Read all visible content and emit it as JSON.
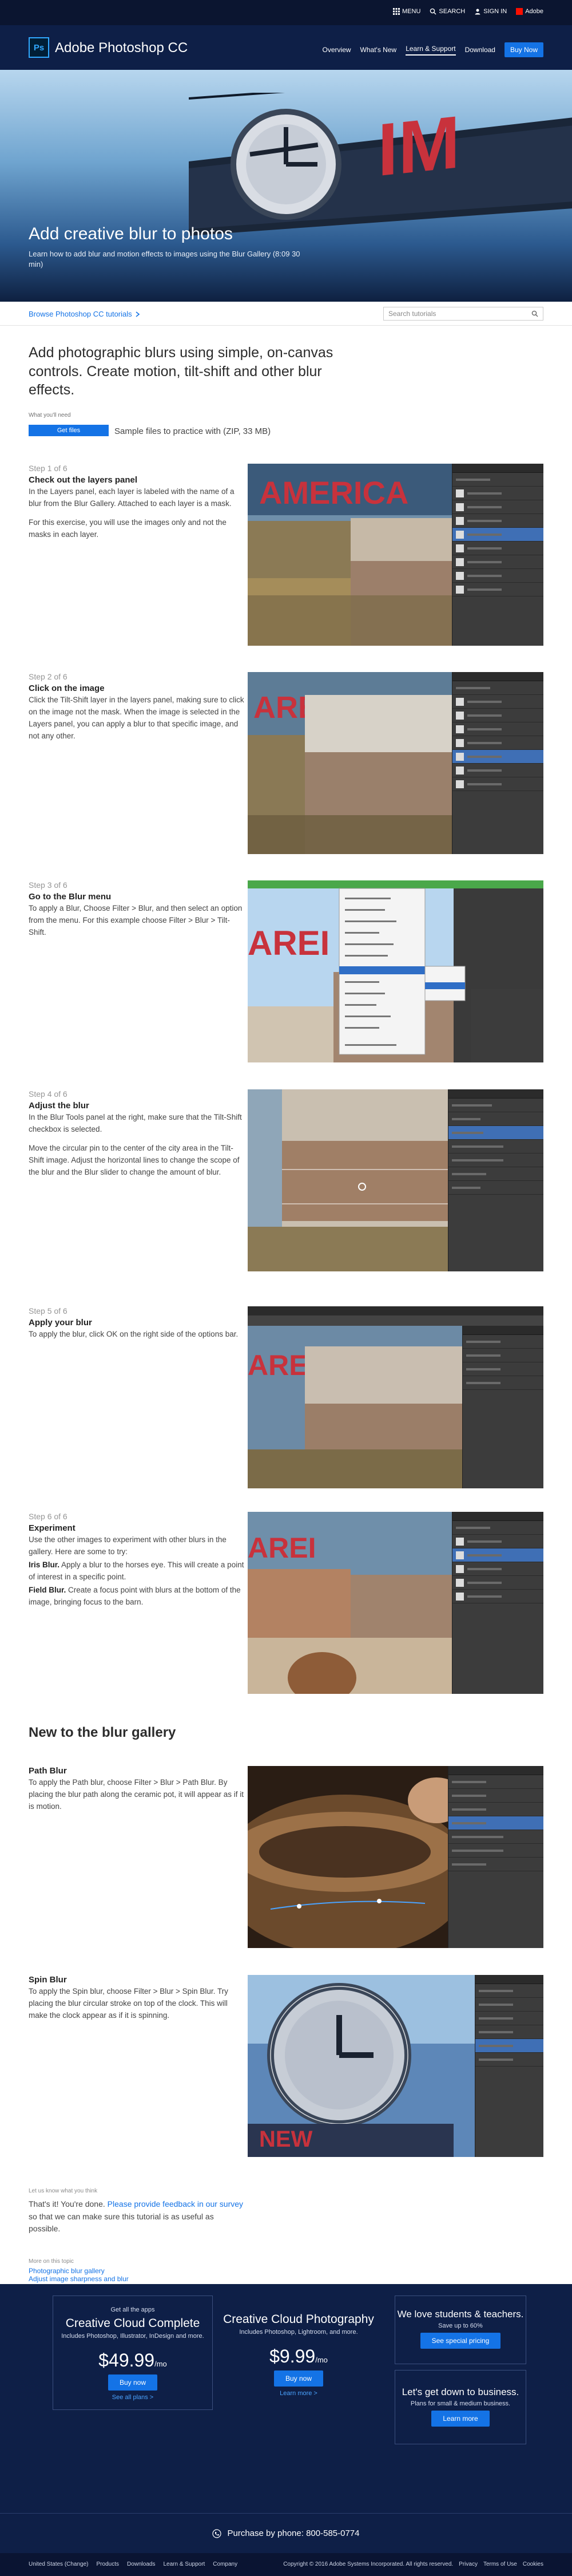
{
  "global_nav": {
    "menu": "MENU",
    "search": "SEARCH",
    "sign_in": "SIGN IN",
    "adobe": "Adobe"
  },
  "product_bar": {
    "logo_text": "Ps",
    "title": "Adobe Photoshop CC",
    "nav": [
      "Overview",
      "What's New",
      "Learn & Support",
      "Download"
    ],
    "buy_now": "Buy Now"
  },
  "hero": {
    "title": "Add creative blur to photos",
    "subtitle": "Learn how to add blur and motion effects to images using the Blur Gallery (8:09 30 min)"
  },
  "browse": {
    "link": "Browse Photoshop CC tutorials",
    "search_placeholder": "Search tutorials"
  },
  "intro": {
    "title": "Add photographic blurs using simple, on-canvas controls. Create motion, tilt-shift and other blur effects.",
    "what_you_need": "What you'll need",
    "get_files": "Get files",
    "files_note": "Sample files to practice with (ZIP, 33 MB)"
  },
  "steps": [
    {
      "num": "Step 1 of 6",
      "head": "Check out the layers panel",
      "paras": [
        "In the Layers panel, each layer is labeled with the name of a blur from the Blur Gallery. Attached to each layer is a mask.",
        "For this exercise, you will use the images only and not the masks in each layer."
      ]
    },
    {
      "num": "Step 2 of 6",
      "head": "Click on the image",
      "paras": [
        "Click the Tilt-Shift layer in the layers panel, making sure to click on the image not the mask. When the image is selected in the Layers panel, you can apply a blur to that specific image, and not any other."
      ]
    },
    {
      "num": "Step 3 of 6",
      "head": "Go to the Blur menu",
      "paras": [
        "To apply a Blur, Choose Filter > Blur, and then select an option from the menu. For this example choose Filter > Blur > Tilt-Shift."
      ]
    },
    {
      "num": "Step 4 of 6",
      "head": "Adjust the blur",
      "paras": [
        "In the Blur Tools panel at the right, make sure that the Tilt-Shift checkbox is selected.",
        "Move the circular pin to the center of the city area in the Tilt-Shift image. Adjust the horizontal lines to change the scope of the blur and the Blur slider to change the amount of blur."
      ]
    },
    {
      "num": "Step 5 of 6",
      "head": "Apply your blur",
      "paras": [
        "To apply the blur, click OK on the right side of the options bar."
      ]
    },
    {
      "num": "Step 6 of 6",
      "head": "Experiment",
      "paras": [
        "Use the other images to experiment with other blurs in the gallery. Here are some to try:"
      ],
      "iris_label": "Iris Blur.",
      "iris_text": " Apply a blur to the horses eye. This will create a point of interest in a specific point.",
      "field_label": "Field Blur.",
      "field_text": " Create a focus point with blurs at the bottom of the image, bringing focus to the barn."
    }
  ],
  "blur_gallery": {
    "title": "New to the blur gallery",
    "items": [
      {
        "head": "Path Blur",
        "text": "To apply the Path blur, choose Filter > Blur > Path Blur. By placing the blur path along the ceramic pot, it will appear as if it is motion."
      },
      {
        "head": "Spin Blur",
        "text": "To apply the Spin blur, choose Filter > Blur > Spin Blur. Try placing the blur circular stroke on top of the clock. This will make the clock appear as if it is spinning."
      }
    ]
  },
  "finish": {
    "small": "Let us know what you think",
    "before": "That's it! You're done. ",
    "link": "Please provide feedback in our survey",
    "after": " so that we can make sure this tutorial is as useful as possible.",
    "more_small": "More on this topic",
    "more_links": [
      "Photographic blur gallery",
      "Adjust image sharpness and blur"
    ]
  },
  "promo": {
    "card1": {
      "small": "Get all the apps",
      "big": "Creative Cloud Complete",
      "sub": "Includes Photoshop, Illustrator, InDesign and more.",
      "price": "$49.99",
      "per": "/mo",
      "btn": "Buy now",
      "link": "See all plans >"
    },
    "card2": {
      "big": "Creative Cloud Photography",
      "sub": "Includes Photoshop, Lightroom, and more.",
      "price": "$9.99",
      "per": "/mo",
      "btn": "Buy now",
      "link": "Learn more >"
    },
    "card3": {
      "big": "We love students & teachers.",
      "small": "Save up to 60%",
      "btn": "See special pricing"
    },
    "card4": {
      "big": "Let's get down to business.",
      "small": "Plans for small & medium business.",
      "btn": "Learn more"
    }
  },
  "phone": "Purchase by phone: 800-585-0774",
  "footer": {
    "region": "United States (Change)",
    "links": [
      "Products",
      "Downloads",
      "Learn & Support",
      "Company"
    ],
    "copyright": "Copyright © 2016 Adobe Systems Incorporated. All rights reserved.",
    "legal": [
      "Privacy",
      "Terms of Use",
      "Cookies"
    ]
  },
  "colors": {
    "accent": "#1473e6",
    "nav_bg": "#0e1f47",
    "topbar_bg": "#0b1530",
    "ps_blue": "#31a8ff"
  }
}
